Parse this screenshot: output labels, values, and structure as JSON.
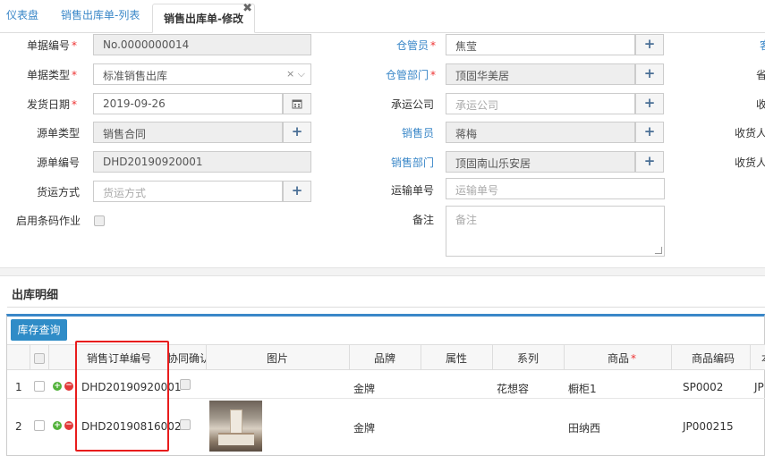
{
  "tabs": [
    {
      "label": "仪表盘"
    },
    {
      "label": "销售出库单-列表"
    },
    {
      "label": "销售出库单-修改",
      "close": "✖"
    }
  ],
  "form": {
    "doc_no": {
      "label": "单据编号",
      "value": "No.0000000014"
    },
    "doc_type": {
      "label": "单据类型",
      "value": "标准销售出库",
      "icons": "× ⌵"
    },
    "ship_date": {
      "label": "发货日期",
      "value": "2019-09-26"
    },
    "source_type": {
      "label": "源单类型",
      "value": "销售合同"
    },
    "source_no": {
      "label": "源单编号",
      "value": "DHD20190920001"
    },
    "freight_method": {
      "label": "货运方式",
      "placeholder": "货运方式"
    },
    "barcode": {
      "label": "启用条码作业"
    },
    "keeper": {
      "label": "仓管员",
      "value": "焦莹"
    },
    "keeper_dept": {
      "label": "仓管部门",
      "value": "顶固华美居"
    },
    "carrier": {
      "label": "承运公司",
      "placeholder": "承运公司"
    },
    "salesman": {
      "label": "销售员",
      "value": "蒋梅"
    },
    "sales_dept": {
      "label": "销售部门",
      "value": "顶固南山乐安居"
    },
    "tracking_no": {
      "label": "运输单号",
      "placeholder": "运输单号"
    },
    "remark": {
      "label": "备注",
      "placeholder": "备注"
    },
    "right_col_labels": [
      "客",
      "省",
      "收",
      "收货人",
      "收货人"
    ]
  },
  "section": {
    "title": "出库明细",
    "query_button": "库存查询"
  },
  "grid": {
    "headers": [
      "销售订单编号",
      "协同确认",
      "图片",
      "品牌",
      "属性",
      "系列",
      "商品",
      "商品编码",
      "本"
    ],
    "rows": [
      {
        "no": "1",
        "order_no": "DHD20190920001",
        "brand": "金牌",
        "series": "花想容",
        "product": "橱柜1",
        "code": "SP0002",
        "extra": "JP"
      },
      {
        "no": "2",
        "order_no": "DHD20190816002",
        "brand": "金牌",
        "series": "",
        "product": "田纳西",
        "code": "JP000215",
        "extra": ""
      }
    ]
  },
  "colors": {
    "accent": "#3a87c8",
    "highlight": "#e81c1c",
    "required": "#e33333"
  }
}
